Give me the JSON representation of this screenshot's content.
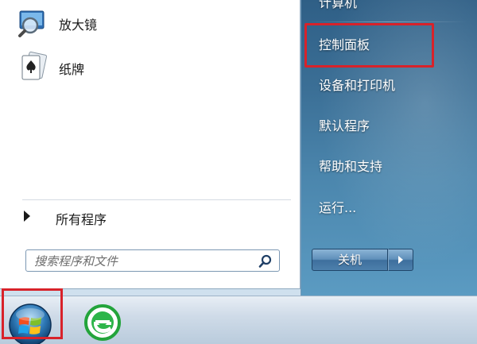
{
  "start_menu": {
    "pinned_programs": [
      {
        "label": "放大镜",
        "icon": "magnifier-icon"
      },
      {
        "label": "纸牌",
        "icon": "solitaire-card-icon"
      }
    ],
    "all_programs_label": "所有程序",
    "search": {
      "placeholder": "搜索程序和文件",
      "value": ""
    },
    "right_items": {
      "computer": "计算机",
      "control_panel": "控制面板",
      "devices_printers": "设备和打印机",
      "default_programs": "默认程序",
      "help_support": "帮助和支持",
      "run": "运行..."
    },
    "shutdown_label": "关机"
  },
  "taskbar": {
    "items": [
      {
        "icon": "windows-start-orb-icon"
      },
      {
        "icon": "green-e-browser-icon"
      }
    ]
  },
  "annotations": {
    "highlight_color": "#d8222a",
    "highlighted": [
      "control_panel",
      "start_button"
    ]
  }
}
